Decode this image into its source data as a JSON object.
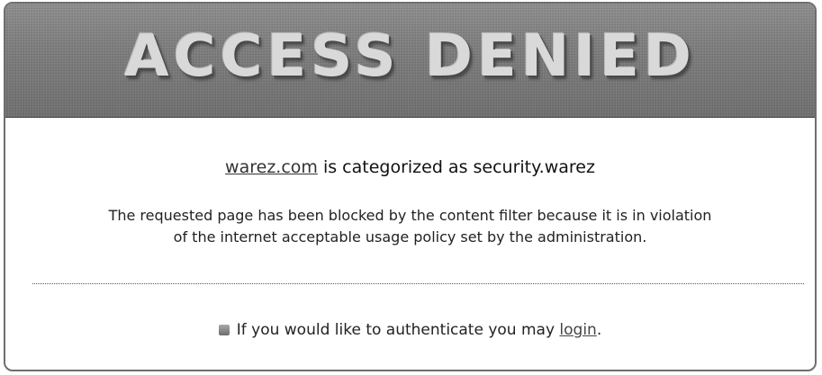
{
  "banner": {
    "title": "ACCESS DENIED"
  },
  "category": {
    "domain": "warez.com",
    "text": " is categorized as security.warez"
  },
  "message": {
    "line1": "The requested page has been blocked by the content filter because it is in violation",
    "line2": "of the internet acceptable usage policy set by the administration."
  },
  "auth": {
    "icon": "bullet-square-icon",
    "prefix": "If you would like to authenticate you may ",
    "login_label": "login",
    "suffix": "."
  }
}
